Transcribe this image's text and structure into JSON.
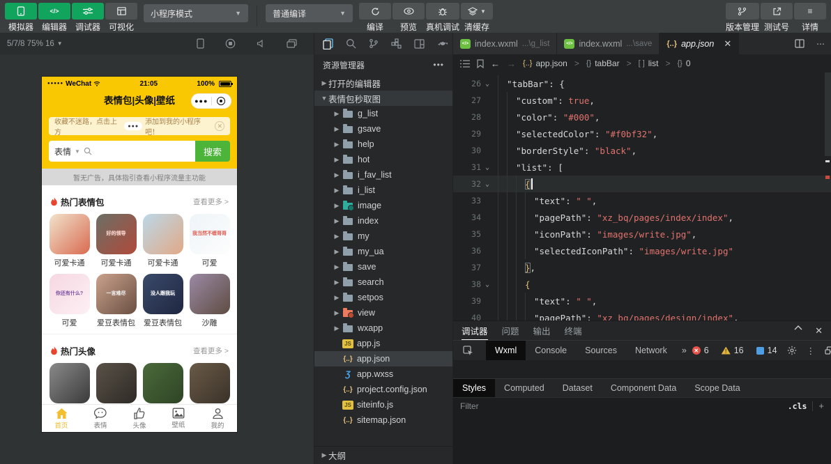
{
  "toolbar": {
    "mode_buttons": [
      {
        "label": "模拟器",
        "active": true
      },
      {
        "label": "编辑器",
        "active": true
      },
      {
        "label": "调试器",
        "active": true
      },
      {
        "label": "可视化",
        "active": false
      }
    ],
    "mode_select": "小程序模式",
    "compile_select": "普通编译",
    "actions": [
      {
        "label": "编译"
      },
      {
        "label": "预览"
      },
      {
        "label": "真机调试"
      },
      {
        "label": "清缓存"
      }
    ],
    "right_actions": [
      {
        "label": "版本管理"
      },
      {
        "label": "测试号"
      },
      {
        "label": "详情"
      }
    ]
  },
  "simulator": {
    "device_info": "5/7/8 75% 16",
    "phone": {
      "status": {
        "signal_dots": "●●●●●",
        "carrier": "WeChat",
        "time": "21:05",
        "battery": "100%"
      },
      "nav_title": "表情包|头像|壁纸",
      "capsule_dots": "●●●",
      "notice_prefix": "收藏不迷路，点击上方",
      "notice_pill": "●●●",
      "notice_suffix": "添加到我的小程序吧！",
      "search": {
        "category": "表情",
        "button": "搜索"
      },
      "ad_text": "暂无广告，具体指引查看小程序流量主功能",
      "sections": [
        {
          "title": "热门表情包",
          "more": "查看更多 >"
        },
        {
          "title": "热门头像",
          "more": "查看更多 >"
        }
      ],
      "emoji_grid": [
        {
          "caption": "可爱卡通",
          "overlay": "",
          "overlay_color": "#fff",
          "bg": [
            "#f2e3cc",
            "#d86a50"
          ]
        },
        {
          "caption": "可爱卡通",
          "overlay": "好的领导",
          "overlay_color": "#ffd7d0",
          "bg": [
            "#6b6f66",
            "#b04a3a"
          ]
        },
        {
          "caption": "可爱卡通",
          "overlay": "",
          "overlay_color": "#fff",
          "bg": [
            "#bcd8e8",
            "#e0a987"
          ]
        },
        {
          "caption": "可爱",
          "overlay": "我当然不缠哥哥",
          "overlay_color": "#e05a4e",
          "bg": [
            "#eef4f8",
            "#fdfdfd"
          ]
        },
        {
          "caption": "可爱",
          "overlay": "你还有什么?",
          "overlay_color": "#7a4fa0",
          "bg": [
            "#f6d7e2",
            "#fdf0f4"
          ]
        },
        {
          "caption": "爱豆表情包",
          "overlay": "一言难尽",
          "overlay_color": "#f0f0f0",
          "bg": [
            "#caa28c",
            "#6a4f42"
          ]
        },
        {
          "caption": "爱豆表情包",
          "overlay": "没人跟我玩",
          "overlay_color": "#ffffff",
          "bg": [
            "#3a4a6b",
            "#1f2740"
          ]
        },
        {
          "caption": "沙雕",
          "overlay": "",
          "overlay_color": "#d8cfe0",
          "bg": [
            "#9b8aa5",
            "#5e4c42"
          ]
        }
      ],
      "avatar_colors": [
        [
          "#8a8a8a",
          "#3a3a3a"
        ],
        [
          "#5a5248",
          "#2e2a26"
        ],
        [
          "#4a6a3a",
          "#2f4426"
        ],
        [
          "#6a5a48",
          "#3a3228"
        ]
      ],
      "tabbar": [
        {
          "label": "首页",
          "active": true
        },
        {
          "label": "表情",
          "active": false
        },
        {
          "label": "头像",
          "active": false
        },
        {
          "label": "壁纸",
          "active": false
        },
        {
          "label": "我的",
          "active": false
        }
      ]
    }
  },
  "explorer": {
    "title": "资源管理器",
    "open_editors": "打开的编辑器",
    "project_name": "表情包秒取图",
    "folders": [
      {
        "name": "g_list"
      },
      {
        "name": "gsave"
      },
      {
        "name": "help"
      },
      {
        "name": "hot"
      },
      {
        "name": "i_fav_list"
      },
      {
        "name": "i_list"
      },
      {
        "name": "image",
        "color": "teal"
      },
      {
        "name": "index"
      },
      {
        "name": "my"
      },
      {
        "name": "my_ua"
      },
      {
        "name": "save"
      },
      {
        "name": "search"
      },
      {
        "name": "setpos"
      },
      {
        "name": "view",
        "color": "coral"
      },
      {
        "name": "wxapp"
      }
    ],
    "files": [
      {
        "name": "app.js",
        "type": "js"
      },
      {
        "name": "app.json",
        "type": "json",
        "selected": true
      },
      {
        "name": "app.wxss",
        "type": "wxss"
      },
      {
        "name": "project.config.json",
        "type": "json"
      },
      {
        "name": "siteinfo.js",
        "type": "js"
      },
      {
        "name": "sitemap.json",
        "type": "json"
      }
    ],
    "outline": "大纲"
  },
  "editor_tabs": [
    {
      "name": "index.wxml",
      "hint": "...\\g_list",
      "active": false
    },
    {
      "name": "index.wxml",
      "hint": "...\\save",
      "active": false
    },
    {
      "name": "app.json",
      "hint": "",
      "active": true
    }
  ],
  "breadcrumb": {
    "segments": [
      {
        "sym": "{..}",
        "name": "app.json"
      },
      {
        "sym": "{}",
        "name": "tabBar"
      },
      {
        "sym": "[ ]",
        "name": "list"
      },
      {
        "sym": "{}",
        "name": "0"
      }
    ]
  },
  "editor": {
    "lines": [
      {
        "n": 26,
        "ind": 1,
        "fold": true,
        "tokens": [
          [
            "k",
            "\"tabBar\""
          ],
          [
            "p",
            ": {"
          ]
        ]
      },
      {
        "n": 27,
        "ind": 2,
        "tokens": [
          [
            "k",
            "\"custom\""
          ],
          [
            "p",
            ": "
          ],
          [
            "b",
            "true"
          ],
          [
            "p",
            ","
          ]
        ]
      },
      {
        "n": 28,
        "ind": 2,
        "tokens": [
          [
            "k",
            "\"color\""
          ],
          [
            "p",
            ": "
          ],
          [
            "s",
            "\"#000\""
          ],
          [
            "p",
            ","
          ]
        ]
      },
      {
        "n": 29,
        "ind": 2,
        "tokens": [
          [
            "k",
            "\"selectedColor\""
          ],
          [
            "p",
            ": "
          ],
          [
            "s",
            "\"#f0bf32\""
          ],
          [
            "p",
            ","
          ]
        ]
      },
      {
        "n": 30,
        "ind": 2,
        "tokens": [
          [
            "k",
            "\"borderStyle\""
          ],
          [
            "p",
            ": "
          ],
          [
            "s",
            "\"black\""
          ],
          [
            "p",
            ","
          ]
        ]
      },
      {
        "n": 31,
        "ind": 2,
        "fold": true,
        "tokens": [
          [
            "k",
            "\"list\""
          ],
          [
            "p",
            ": ["
          ]
        ]
      },
      {
        "n": 32,
        "ind": 3,
        "fold": true,
        "cur": true,
        "caret": true,
        "tokens": [
          [
            "m",
            "{"
          ]
        ]
      },
      {
        "n": 33,
        "ind": 4,
        "tokens": [
          [
            "k",
            "\"text\""
          ],
          [
            "p",
            ": "
          ],
          [
            "s",
            "\" \""
          ],
          [
            "p",
            ","
          ]
        ]
      },
      {
        "n": 34,
        "ind": 4,
        "tokens": [
          [
            "k",
            "\"pagePath\""
          ],
          [
            "p",
            ": "
          ],
          [
            "s",
            "\"xz_bq/pages/index/index\""
          ],
          [
            "p",
            ","
          ]
        ]
      },
      {
        "n": 35,
        "ind": 4,
        "tokens": [
          [
            "k",
            "\"iconPath\""
          ],
          [
            "p",
            ": "
          ],
          [
            "s",
            "\"images/write.jpg\""
          ],
          [
            "p",
            ","
          ]
        ]
      },
      {
        "n": 36,
        "ind": 4,
        "tokens": [
          [
            "k",
            "\"selectedIconPath\""
          ],
          [
            "p",
            ": "
          ],
          [
            "s",
            "\"images/write.jpg\""
          ]
        ]
      },
      {
        "n": 37,
        "ind": 3,
        "tokens": [
          [
            "m",
            "}"
          ],
          [
            "p",
            ","
          ]
        ]
      },
      {
        "n": 38,
        "ind": 3,
        "fold": true,
        "tokens": [
          [
            "y",
            "{"
          ]
        ]
      },
      {
        "n": 39,
        "ind": 4,
        "tokens": [
          [
            "k",
            "\"text\""
          ],
          [
            "p",
            ": "
          ],
          [
            "s",
            "\" \""
          ],
          [
            "p",
            ","
          ]
        ]
      },
      {
        "n": 40,
        "ind": 4,
        "tokens": [
          [
            "k",
            "\"pagePath\""
          ],
          [
            "p",
            ": "
          ],
          [
            "s",
            "\"xz_bq/pages/design/index\""
          ],
          [
            "p",
            ","
          ]
        ]
      }
    ]
  },
  "debugger": {
    "tabs": [
      {
        "label": "调试器",
        "active": true
      },
      {
        "label": "问题",
        "active": false
      },
      {
        "label": "输出",
        "active": false
      },
      {
        "label": "终端",
        "active": false
      }
    ],
    "devtools_tabs": [
      {
        "label": "Wxml",
        "active": true
      },
      {
        "label": "Console",
        "active": false
      },
      {
        "label": "Sources",
        "active": false
      },
      {
        "label": "Network",
        "active": false
      }
    ],
    "counts": {
      "errors": "6",
      "warnings": "16",
      "messages": "14"
    },
    "style_tabs": [
      {
        "label": "Styles",
        "active": true
      },
      {
        "label": "Computed",
        "active": false
      },
      {
        "label": "Dataset",
        "active": false
      },
      {
        "label": "Component Data",
        "active": false
      },
      {
        "label": "Scope Data",
        "active": false
      }
    ],
    "filter_placeholder": "Filter",
    "cls_label": ".cls",
    "accent_selected_color": "#f0bf32"
  }
}
